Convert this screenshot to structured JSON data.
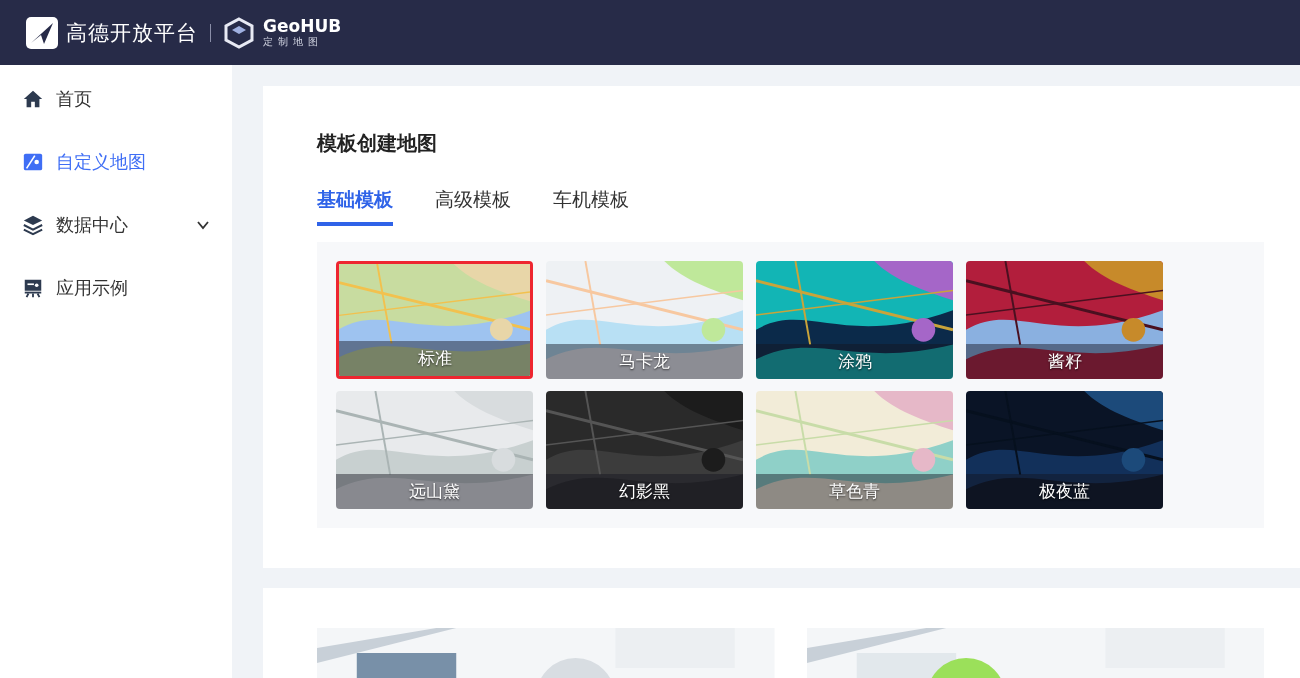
{
  "header": {
    "brand": "高德开放平台",
    "product": "GeoHUB",
    "product_sub": "定制地图"
  },
  "sidebar": {
    "items": [
      {
        "label": "首页",
        "selected": false
      },
      {
        "label": "自定义地图",
        "selected": true
      },
      {
        "label": "数据中心",
        "selected": false,
        "expanded": false
      },
      {
        "label": "应用示例",
        "selected": false
      }
    ]
  },
  "section": {
    "title": "模板创建地图",
    "tabs": [
      {
        "label": "基础模板",
        "selected": true
      },
      {
        "label": "高级模板",
        "selected": false
      },
      {
        "label": "车机模板",
        "selected": false
      }
    ],
    "templates": [
      {
        "name": "标准",
        "selected": true
      },
      {
        "name": "马卡龙",
        "selected": false
      },
      {
        "name": "涂鸦",
        "selected": false
      },
      {
        "name": "酱籽",
        "selected": false
      },
      {
        "name": "远山黛",
        "selected": false
      },
      {
        "name": "幻影黑",
        "selected": false
      },
      {
        "name": "草色青",
        "selected": false
      },
      {
        "name": "极夜蓝",
        "selected": false
      }
    ]
  }
}
